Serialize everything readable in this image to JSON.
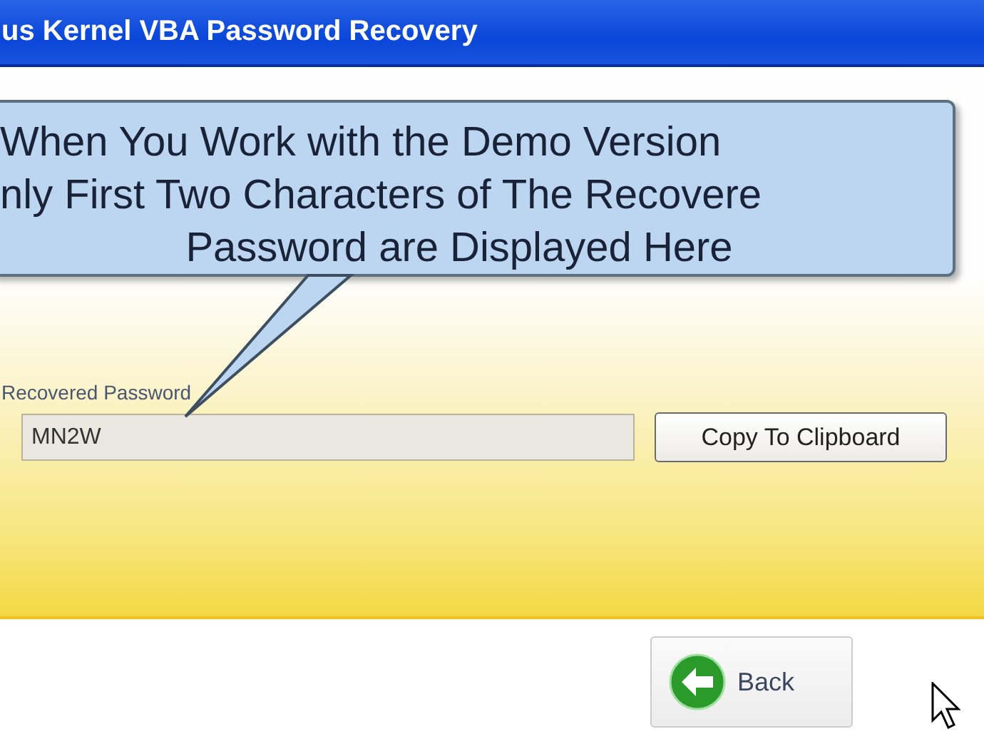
{
  "window": {
    "title": "us Kernel VBA Password Recovery"
  },
  "callout": {
    "lines": [
      "When You Work with the Demo Version",
      "nly First Two Characters of The Recovere",
      "Password are Displayed Here"
    ]
  },
  "recovered_password": {
    "label": "Recovered Password",
    "value": "MN2W",
    "copy_button": "Copy To Clipboard"
  },
  "footer": {
    "back_button": "Back"
  }
}
